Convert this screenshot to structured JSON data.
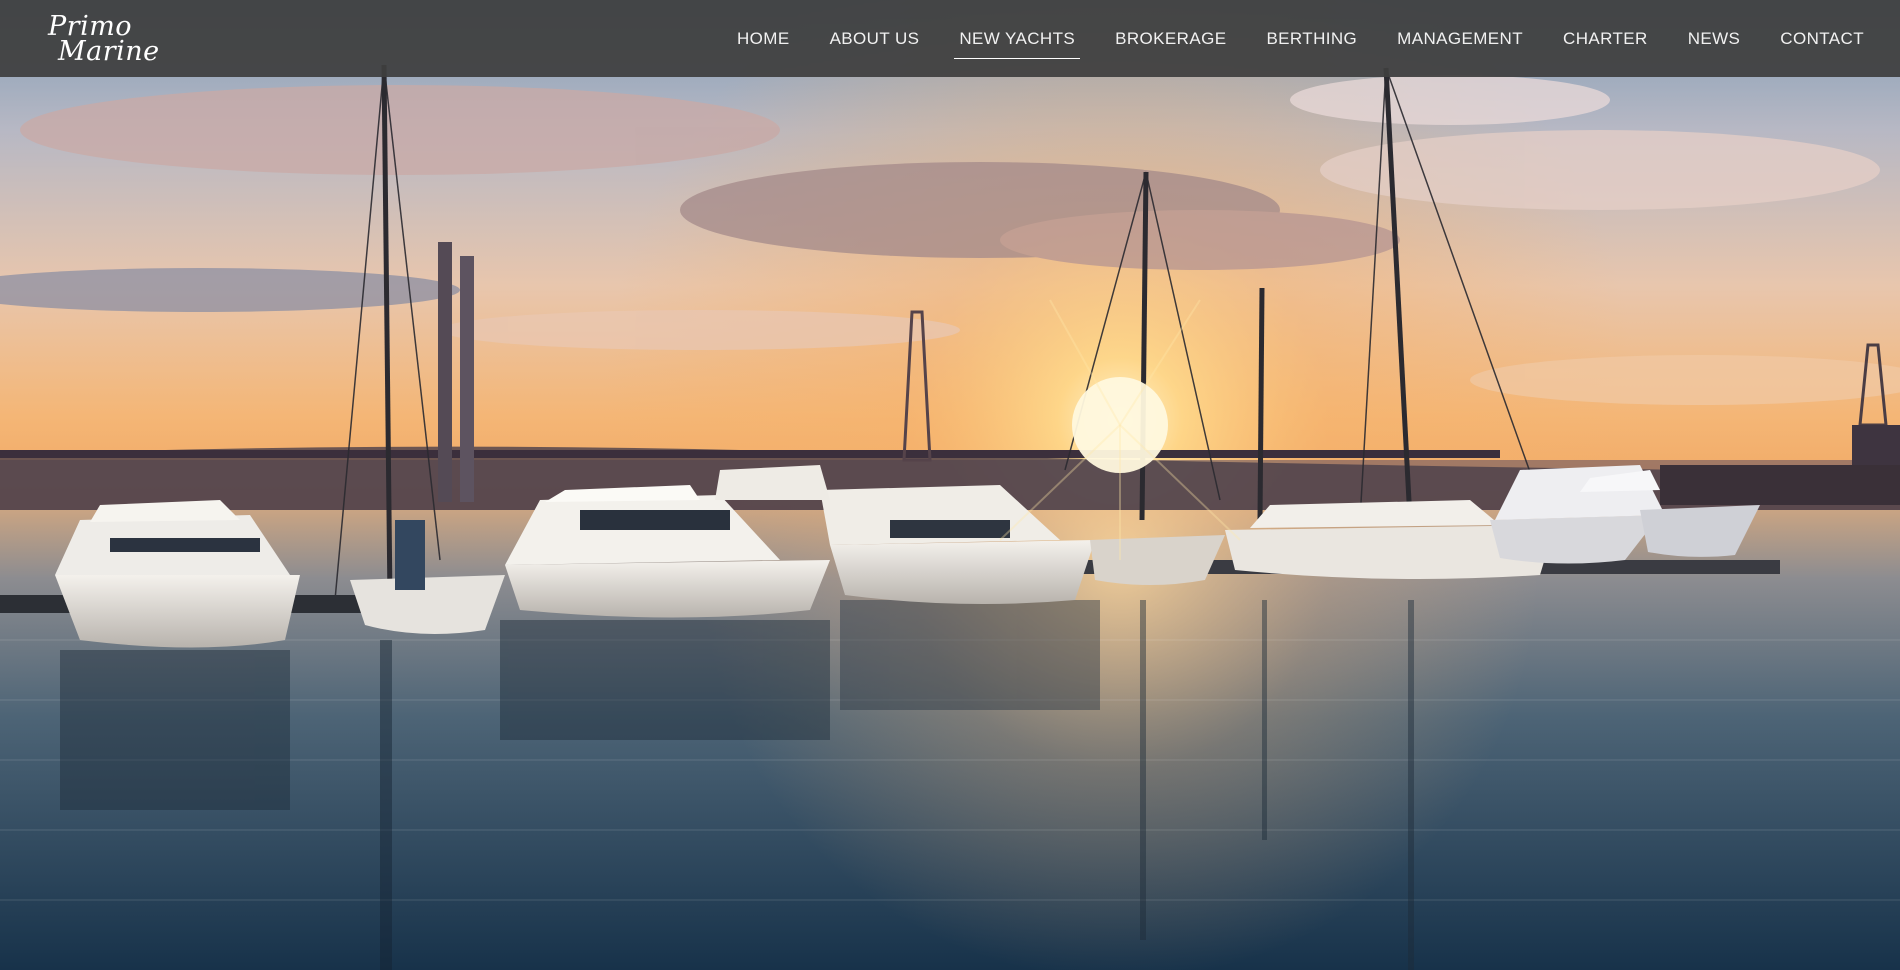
{
  "brand": {
    "logo_line1": "Primo",
    "logo_line2": "Marine"
  },
  "nav": {
    "active_index": 2,
    "items": [
      {
        "label": "HOME"
      },
      {
        "label": "ABOUT US"
      },
      {
        "label": "NEW YACHTS"
      },
      {
        "label": "BROKERAGE"
      },
      {
        "label": "BERTHING"
      },
      {
        "label": "MANAGEMENT"
      },
      {
        "label": "CHARTER"
      },
      {
        "label": "NEWS"
      },
      {
        "label": "CONTACT"
      }
    ]
  },
  "hero": {
    "scene": "marina-sunset-photo"
  },
  "colors": {
    "topbar": "#3e3e3e",
    "nav_text": "#f1f1f1",
    "sun": "#ffd27a",
    "water": "#1e3a52"
  }
}
